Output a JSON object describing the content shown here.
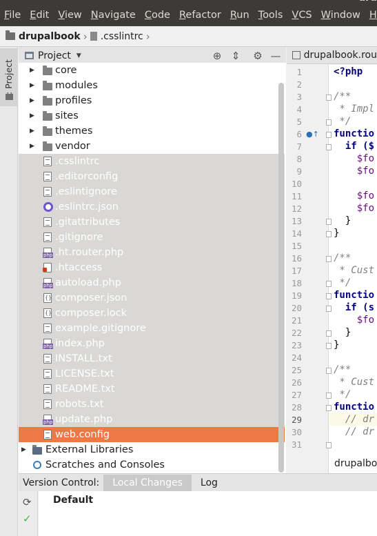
{
  "window": {
    "title_fragment": "dru"
  },
  "menu": [
    "File",
    "Edit",
    "View",
    "Navigate",
    "Code",
    "Refactor",
    "Run",
    "Tools",
    "VCS",
    "Window",
    "Help"
  ],
  "breadcrumb": {
    "project": "drupalbook",
    "file": ".csslintrc"
  },
  "left_strip": {
    "project_tab": "1: Project"
  },
  "project_panel": {
    "title": "Project",
    "dropdown_icon": "caret-down-icon",
    "icons": [
      "target-icon",
      "collapse-icon",
      "gear-icon",
      "minimize-icon"
    ]
  },
  "tree": {
    "folders": [
      {
        "label": "core"
      },
      {
        "label": "modules"
      },
      {
        "label": "profiles"
      },
      {
        "label": "sites"
      },
      {
        "label": "themes"
      },
      {
        "label": "vendor"
      }
    ],
    "files": [
      {
        "label": ".csslintrc",
        "icon": "file"
      },
      {
        "label": ".editorconfig",
        "icon": "file"
      },
      {
        "label": ".eslintignore",
        "icon": "file"
      },
      {
        "label": ".eslintrc.json",
        "icon": "eslint"
      },
      {
        "label": ".gitattributes",
        "icon": "file"
      },
      {
        "label": ".gitignore",
        "icon": "file"
      },
      {
        "label": ".ht.router.php",
        "icon": "php"
      },
      {
        "label": ".htaccess",
        "icon": "htaccess"
      },
      {
        "label": "autoload.php",
        "icon": "php"
      },
      {
        "label": "composer.json",
        "icon": "json"
      },
      {
        "label": "composer.lock",
        "icon": "json"
      },
      {
        "label": "example.gitignore",
        "icon": "file"
      },
      {
        "label": "index.php",
        "icon": "php"
      },
      {
        "label": "INSTALL.txt",
        "icon": "file"
      },
      {
        "label": "LICENSE.txt",
        "icon": "file"
      },
      {
        "label": "README.txt",
        "icon": "file"
      },
      {
        "label": "robots.txt",
        "icon": "file"
      },
      {
        "label": "update.php",
        "icon": "php"
      },
      {
        "label": "web.config",
        "icon": "file"
      }
    ],
    "selected": "web.config",
    "external_libraries": "External Libraries",
    "scratches": "Scratches and Consoles"
  },
  "editor": {
    "tab": "drupalbook.rou",
    "lines": [
      {
        "n": "1",
        "text": "<?php",
        "cls": "kw"
      },
      {
        "n": "2",
        "text": "",
        "cls": ""
      },
      {
        "n": "3",
        "text": "/**",
        "cls": "cm"
      },
      {
        "n": "4",
        "text": " * Impl",
        "cls": "cm"
      },
      {
        "n": "5",
        "text": " */",
        "cls": "cm"
      },
      {
        "n": "6",
        "text": "functio",
        "cls": "kw"
      },
      {
        "n": "7",
        "text": "  if ($",
        "cls": "kw"
      },
      {
        "n": "8",
        "text": "    $fo",
        "cls": "var"
      },
      {
        "n": "9",
        "text": "    $fo",
        "cls": "var"
      },
      {
        "n": "10",
        "text": "",
        "cls": ""
      },
      {
        "n": "11",
        "text": "    $fo",
        "cls": "var"
      },
      {
        "n": "12",
        "text": "    $fo",
        "cls": "var"
      },
      {
        "n": "13",
        "text": "  }",
        "cls": ""
      },
      {
        "n": "14",
        "text": "}",
        "cls": ""
      },
      {
        "n": "15",
        "text": "",
        "cls": ""
      },
      {
        "n": "16",
        "text": "/**",
        "cls": "cm"
      },
      {
        "n": "17",
        "text": " * Cust",
        "cls": "cm"
      },
      {
        "n": "18",
        "text": " */",
        "cls": "cm"
      },
      {
        "n": "19",
        "text": "functio",
        "cls": "kw"
      },
      {
        "n": "20",
        "text": "  if (s",
        "cls": "kw"
      },
      {
        "n": "21",
        "text": "    $fo",
        "cls": "var"
      },
      {
        "n": "22",
        "text": "  }",
        "cls": ""
      },
      {
        "n": "23",
        "text": "}",
        "cls": ""
      },
      {
        "n": "24",
        "text": "",
        "cls": ""
      },
      {
        "n": "25",
        "text": "/**",
        "cls": "cm"
      },
      {
        "n": "26",
        "text": " * Cust",
        "cls": "cm"
      },
      {
        "n": "27",
        "text": " */",
        "cls": "cm"
      },
      {
        "n": "28",
        "text": "functio",
        "cls": "kw"
      },
      {
        "n": "29",
        "text": "  // dr",
        "cls": "cm"
      },
      {
        "n": "30",
        "text": "  // dr",
        "cls": "cm"
      },
      {
        "n": "31",
        "text": "",
        "cls": ""
      }
    ],
    "current_line": "29",
    "breadcrumb": "drupalbook"
  },
  "version_control": {
    "title": "Version Control:",
    "tabs": [
      "Local Changes",
      "Log"
    ],
    "active_tab": "Local Changes",
    "changelist": "Default"
  },
  "colors": {
    "selection": "#f07746",
    "menubar": "#3c3b37",
    "dim_row": "#d9d8d6"
  }
}
